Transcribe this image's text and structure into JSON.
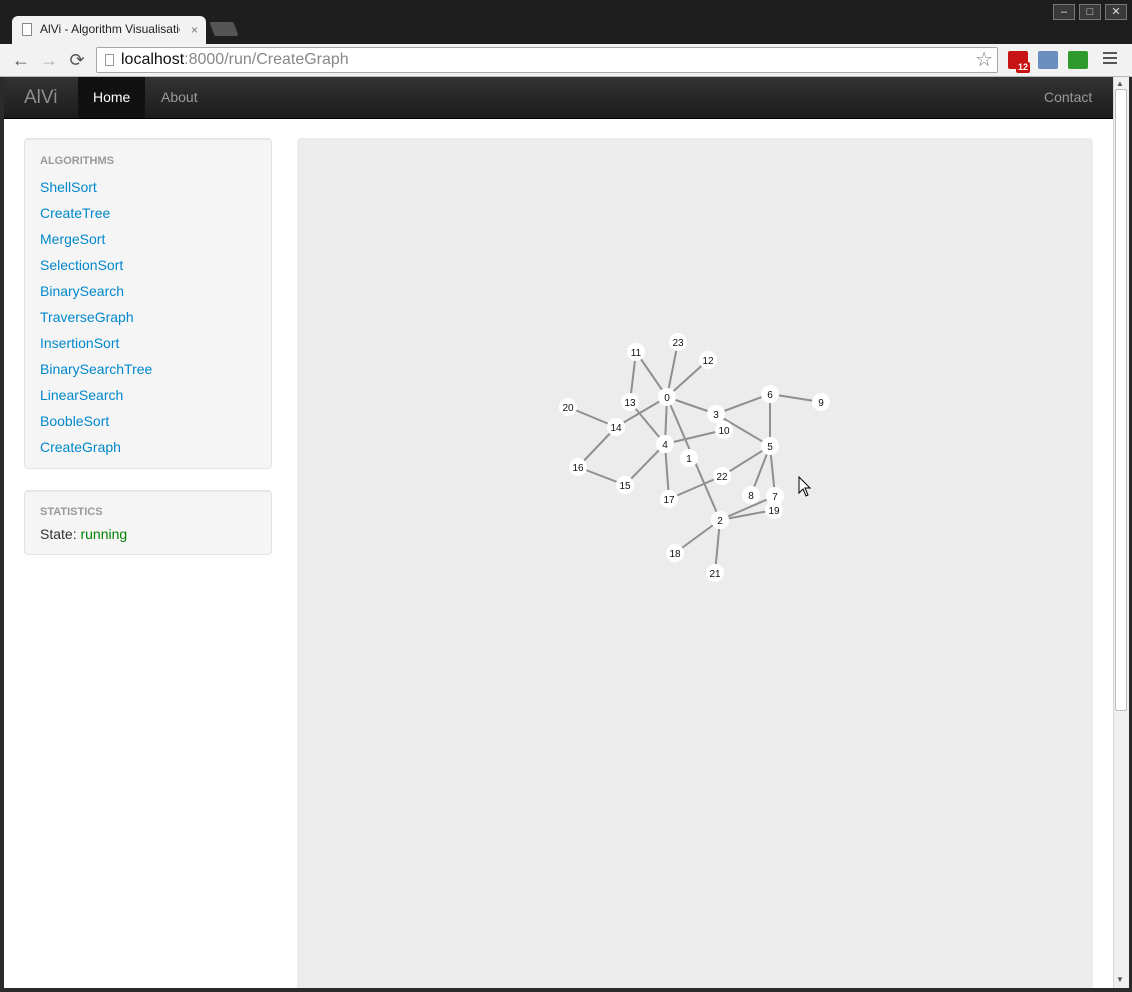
{
  "browser": {
    "tab_title": "AlVi - Algorithm Visualisatio",
    "tab_close": "×",
    "url_host": "localhost",
    "url_rest": ":8000/run/CreateGraph",
    "win_minimize": "–",
    "win_maximize": "□",
    "win_close": "✕",
    "back": "←",
    "forward": "→",
    "reload": "⟳",
    "star": "☆",
    "gmail_badge": "12"
  },
  "navbar": {
    "brand": "AlVi",
    "links": [
      {
        "label": "Home",
        "active": true
      },
      {
        "label": "About",
        "active": false
      }
    ],
    "right_link": "Contact"
  },
  "sidebar": {
    "algorithms_header": "ALGORITHMS",
    "algorithms": [
      "ShellSort",
      "CreateTree",
      "MergeSort",
      "SelectionSort",
      "BinarySearch",
      "TraverseGraph",
      "InsertionSort",
      "BinarySearchTree",
      "LinearSearch",
      "BoobleSort",
      "CreateGraph"
    ],
    "statistics_header": "STATISTICS",
    "state_label": "State:",
    "state_value": "running"
  },
  "graph": {
    "nodes": [
      "0",
      "1",
      "2",
      "3",
      "4",
      "5",
      "6",
      "7",
      "8",
      "9",
      "10",
      "11",
      "12",
      "13",
      "14",
      "15",
      "16",
      "17",
      "18",
      "19",
      "20",
      "21",
      "22",
      "23"
    ],
    "edges": [
      [
        "0",
        "11"
      ],
      [
        "0",
        "23"
      ],
      [
        "0",
        "12"
      ],
      [
        "0",
        "14"
      ],
      [
        "0",
        "3"
      ],
      [
        "0",
        "4"
      ],
      [
        "0",
        "2"
      ],
      [
        "4",
        "13"
      ],
      [
        "4",
        "10"
      ],
      [
        "4",
        "15"
      ],
      [
        "4",
        "17"
      ],
      [
        "13",
        "11"
      ],
      [
        "14",
        "20"
      ],
      [
        "14",
        "16"
      ],
      [
        "16",
        "15"
      ],
      [
        "3",
        "6"
      ],
      [
        "3",
        "5"
      ],
      [
        "6",
        "9"
      ],
      [
        "6",
        "5"
      ],
      [
        "5",
        "22"
      ],
      [
        "5",
        "8"
      ],
      [
        "5",
        "7"
      ],
      [
        "22",
        "17"
      ],
      [
        "2",
        "7"
      ],
      [
        "2",
        "19"
      ],
      [
        "2",
        "18"
      ],
      [
        "2",
        "21"
      ]
    ]
  }
}
